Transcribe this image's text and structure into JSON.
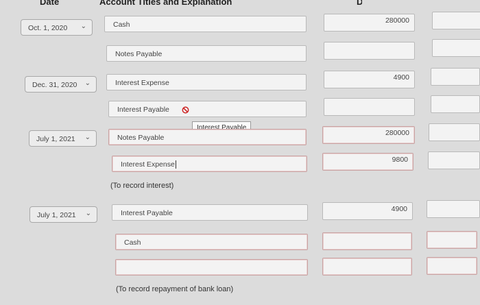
{
  "headers": {
    "date": "Date",
    "account": "Account Titles and Explanation"
  },
  "rows": [
    {
      "date": "Oct. 1, 2020",
      "account": "Cash",
      "debit": "280000"
    },
    {
      "account": "Notes Payable",
      "credit": ""
    },
    {
      "date": "Dec. 31, 2020",
      "account": "Interest Expense",
      "debit": "4900"
    },
    {
      "account": "Interest Payable"
    },
    {
      "date": "July 1, 2021",
      "account": "Notes Payable",
      "debit": "280000"
    },
    {
      "account": "Interest Expense",
      "debit": "9800"
    },
    {
      "date": "July 1, 2021",
      "account": "Interest Payable",
      "debit": "4900"
    },
    {
      "account": "Cash"
    },
    {
      "account": ""
    }
  ],
  "notes": {
    "interest": "(To record interest)",
    "repayment": "(To record repayment of bank loan)"
  },
  "tooltip": "Interest Payable",
  "icons": {
    "dropdown": "chevron-down-icon",
    "error": "no-entry-icon"
  },
  "colors": {
    "error": "#cc2222",
    "invalid_border": "#c9a3a3"
  }
}
